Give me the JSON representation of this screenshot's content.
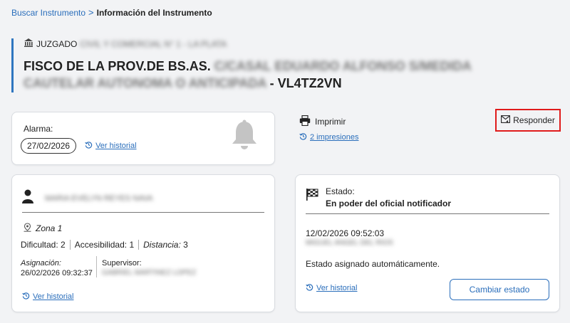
{
  "breadcrumb": {
    "link": "Buscar Instrumento",
    "separator": ">",
    "current": "Información del Instrumento"
  },
  "header": {
    "court_label": "JUZGADO",
    "court_name": "CIVIL Y COMERCIAL N° 1 - LA PLATA",
    "title_start": "FISCO DE LA PROV.DE BS.AS.",
    "title_blurred_1": "C/CASAL EDUARDO ALFONSO S/MEDIDA",
    "title_blurred_2": "CAUTELAR AUTONOMA O ANTICIPADA",
    "title_end": "- VL4TZ2VN"
  },
  "alarm": {
    "label": "Alarma:",
    "date": "27/02/2026",
    "history_link": "Ver historial"
  },
  "actions": {
    "print_label": "Imprimir",
    "impressions_link": "2 impresiones",
    "respond_label": "Responder"
  },
  "person": {
    "name": "MARIA EVELYN REYES NAVA",
    "zone": "Zona 1",
    "difficulty_label": "Dificultad:",
    "difficulty": "2",
    "accessibility_label": "Accesibilidad:",
    "accessibility": "1",
    "distance_label": "Distancia:",
    "distance": "3",
    "assignment_label": "Asignación:",
    "assignment_date": "26/02/2026 09:32:37",
    "supervisor_label": "Supervisor:",
    "supervisor_name": "GABRIEL MARTINEZ LOPEZ",
    "history_link": "Ver historial"
  },
  "state": {
    "label": "Estado:",
    "value": "En poder del oficial notificador",
    "timestamp": "12/02/2026 09:52:03",
    "user": "MIGUEL ANGEL DEL RIOS",
    "note": "Estado asignado automáticamente.",
    "history_link": "Ver historial",
    "change_button": "Cambiar estado"
  },
  "colors": {
    "link": "#2a6ebb",
    "accent_border": "#2f76c0",
    "highlight": "#e01b1b"
  },
  "icons": [
    "chevron-right-icon",
    "courthouse-icon",
    "bell-icon",
    "printer-icon",
    "history-icon",
    "reply-mail-icon",
    "person-icon",
    "location-pin-icon",
    "checkered-flag-icon"
  ]
}
